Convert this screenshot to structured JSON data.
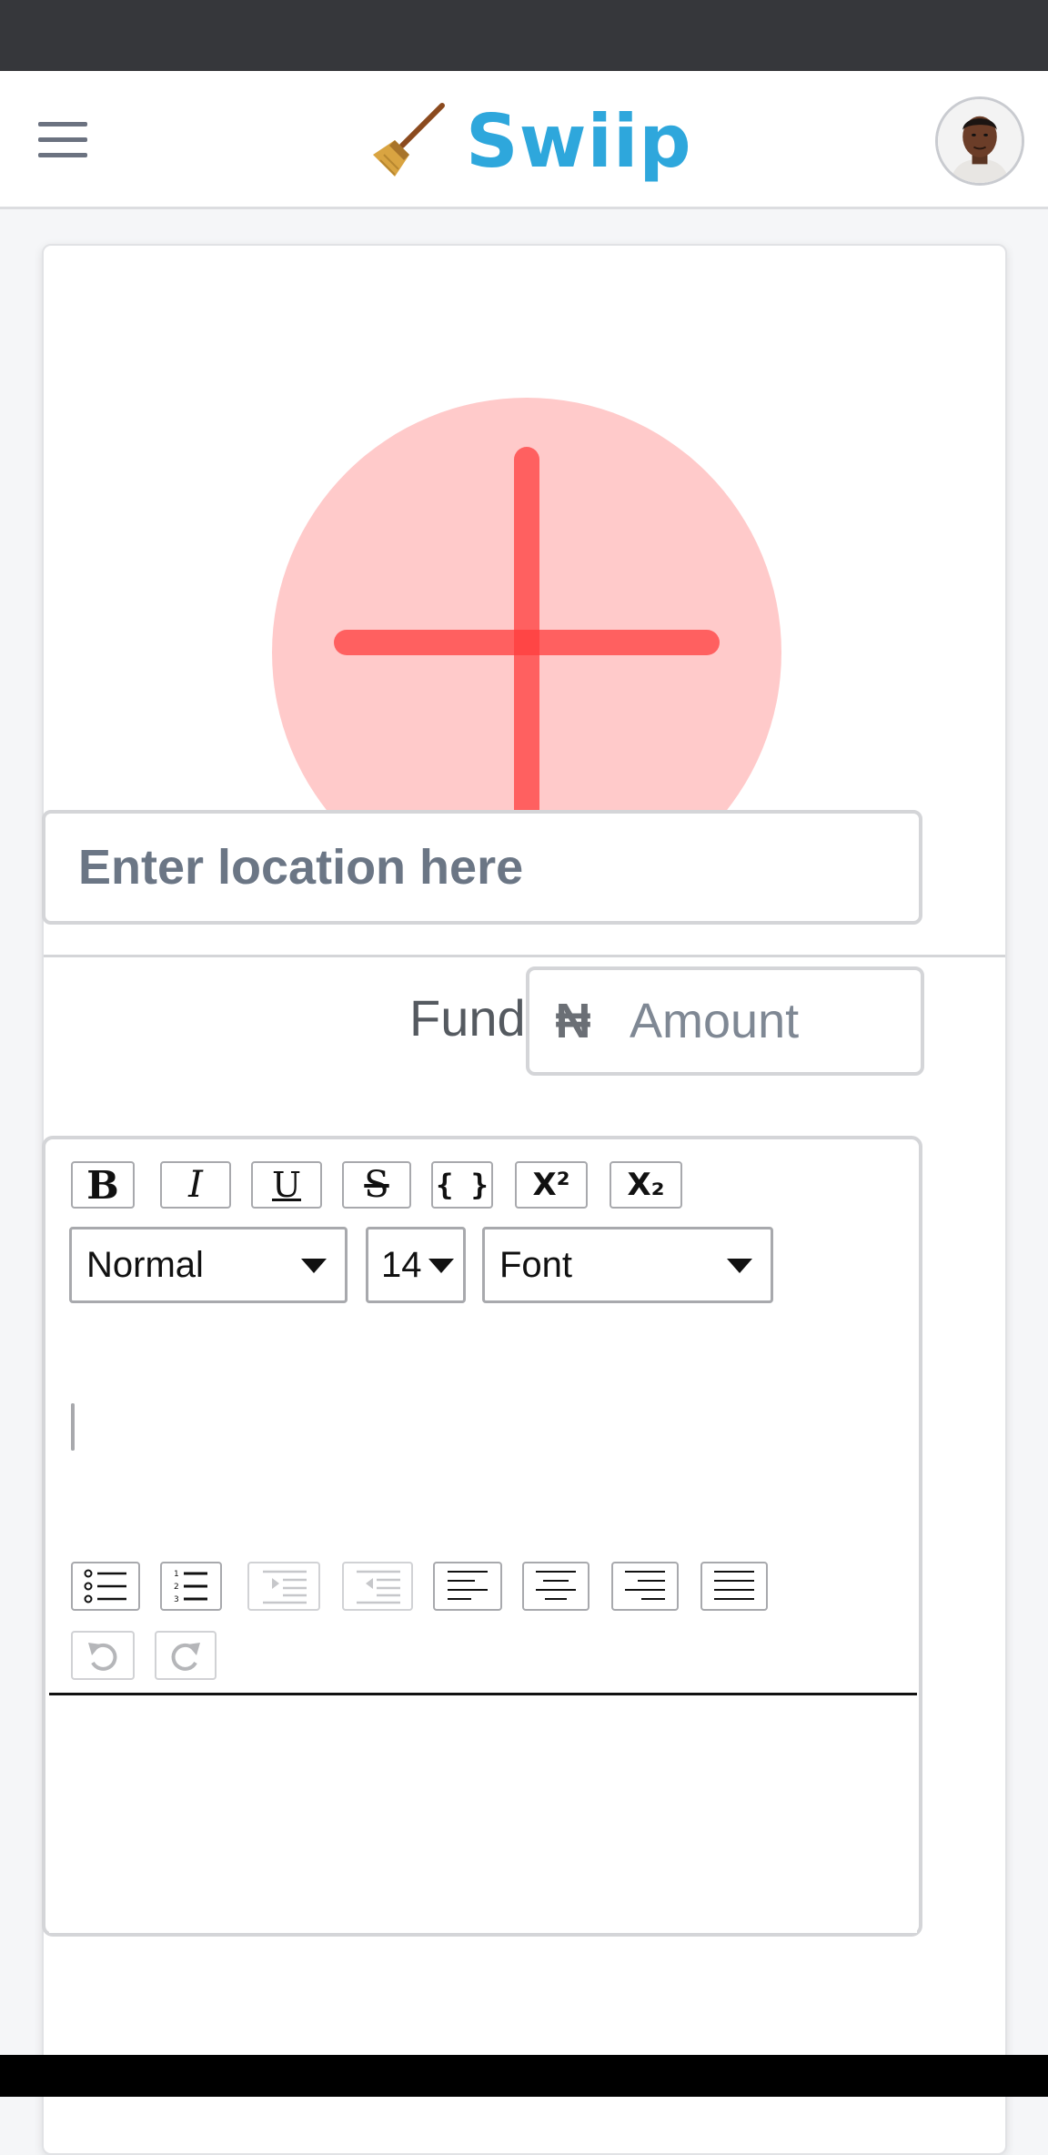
{
  "header": {
    "app_name": "Swiip",
    "menu_icon": "hamburger-menu-icon",
    "brand_icon": "broom-icon",
    "brand_color": "#2ea7dc"
  },
  "upload": {
    "icon": "plus-icon",
    "accent_color": "#ff5a5a"
  },
  "form": {
    "location_placeholder": "Enter location here",
    "location_value": "",
    "fund_label": "Fund:",
    "currency_symbol": "₦",
    "amount_placeholder": "Amount",
    "amount_value": ""
  },
  "editor": {
    "format_buttons": [
      {
        "name": "bold",
        "label": "B"
      },
      {
        "name": "italic",
        "label": "I"
      },
      {
        "name": "underline",
        "label": "U"
      },
      {
        "name": "strikethrough",
        "label": "S"
      },
      {
        "name": "code",
        "label": "{ }"
      },
      {
        "name": "superscript",
        "label": "X²"
      },
      {
        "name": "subscript",
        "label": "X₂"
      }
    ],
    "heading_select": "Normal",
    "size_select": "14",
    "font_select": "Font",
    "list_buttons": [
      "bullet-list-icon",
      "numbered-list-icon",
      "indent-icon",
      "outdent-icon",
      "align-left-icon",
      "align-center-icon",
      "align-right-icon",
      "align-justify-icon"
    ],
    "history_buttons": [
      "undo-icon",
      "redo-icon"
    ],
    "content": ""
  }
}
